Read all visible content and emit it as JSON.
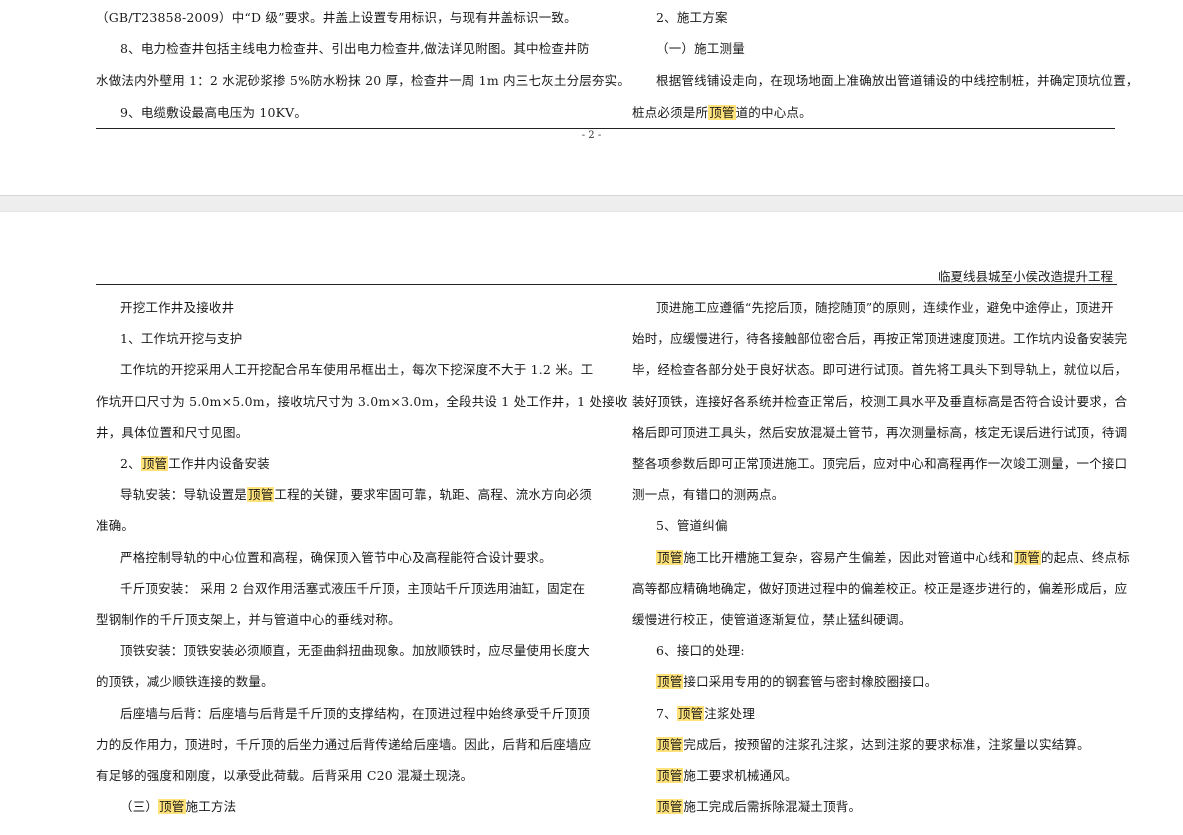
{
  "top_page": {
    "left": [
      "（GB/T23858-2009）中“D 级”要求。井盖上设置专用标识，与现有井盖标识一致。",
      "8、电力检查井包括主线电力检查井、引出电力检查井,做法详见附图。其中检查井防",
      "水做法内外壁用 1：2 水泥砂浆掺 5%防水粉抹 20 厚，检查井一周 1m 内三七灰土分层夯实。",
      "9、电缆敷设最高电压为 10KV。"
    ],
    "right": [
      "2、施工方案",
      "（一）施工测量",
      "根据管线铺设走向，在现场地面上准确放出管道铺设的中线控制桩，并确定顶坑位置，",
      {
        "pre": "桩点必须是所",
        "hl": "顶管",
        "post": "道的中心点。"
      }
    ],
    "page_number": "- 2 -"
  },
  "bottom_page": {
    "header": "临夏线县城至小侯改造提升工程",
    "left": [
      {
        "text": "开挖工作井及接收井",
        "indent": true
      },
      {
        "text": "1、工作坑开挖与支护",
        "indent": true
      },
      {
        "text": "工作坑的开挖采用人工开挖配合吊车使用吊框出土，每次下挖深度不大于 1.2 米。工",
        "indent": true
      },
      {
        "text": "作坑开口尺寸为 5.0m×5.0m，接收坑尺寸为 3.0m×3.0m，全段共设 1 处工作井，1 处接收",
        "indent": false
      },
      {
        "text": "井，具体位置和尺寸见图。",
        "indent": false
      },
      {
        "pre": "2、",
        "hl": "顶管",
        "post": "工作井内设备安装",
        "indent": true
      },
      {
        "pre": "导轨安装：导轨设置是",
        "hl": "顶管",
        "post": "工程的关键，要求牢固可靠，轨距、高程、流水方向必须",
        "indent": true
      },
      {
        "text": "准确。",
        "indent": false
      },
      {
        "text": "严格控制导轨的中心位置和高程，确保顶入管节中心及高程能符合设计要求。",
        "indent": true
      },
      {
        "text": "千斤顶安装： 采用 2 台双作用活塞式液压千斤顶，主顶站千斤顶选用油缸，固定在",
        "indent": true
      },
      {
        "text": "型钢制作的千斤顶支架上，并与管道中心的垂线对称。",
        "indent": false
      },
      {
        "text": "顶铁安装：顶铁安装必须顺直，无歪曲斜扭曲现象。加放顺铁时，应尽量使用长度大",
        "indent": true
      },
      {
        "text": "的顶铁，减少顺铁连接的数量。",
        "indent": false
      },
      {
        "text": "后座墙与后背：后座墙与后背是千斤顶的支撑结构，在顶进过程中始终承受千斤顶顶",
        "indent": true
      },
      {
        "text": "力的反作用力，顶进时，千斤顶的后坐力通过后背传递给后座墙。因此，后背和后座墙应",
        "indent": false
      },
      {
        "text": "有足够的强度和刚度，以承受此荷载。后背采用 C20 混凝土现浇。",
        "indent": false
      },
      {
        "pre": "（三）",
        "hl": "顶管",
        "post": "施工方法",
        "indent": true
      }
    ],
    "right": [
      {
        "text": "顶进施工应遵循“先挖后顶，随挖随顶”的原则，连续作业，避免中途停止，顶进开",
        "indent": true
      },
      {
        "text": "始时，应缓慢进行，待各接触部位密合后，再按正常顶进速度顶进。工作坑内设备安装完",
        "indent": false
      },
      {
        "text": "毕，经检查各部分处于良好状态。即可进行试顶。首先将工具头下到导轨上，就位以后，",
        "indent": false
      },
      {
        "text": "装好顶铁，连接好各系统并检查正常后，校测工具水平及垂直标高是否符合设计要求，合",
        "indent": false
      },
      {
        "text": "格后即可顶进工具头，然后安放混凝土管节，再次测量标高，核定无误后进行试顶，待调",
        "indent": false
      },
      {
        "text": "整各项参数后即可正常顶进施工。顶完后，应对中心和高程再作一次竣工测量，一个接口",
        "indent": false
      },
      {
        "text": "测一点，有错口的测两点。",
        "indent": false
      },
      {
        "text": "5、管道纠偏",
        "indent": true
      },
      {
        "hl": "顶管",
        "mid": "施工比开槽施工复杂，容易产生偏差，因此对管道中心线和",
        "hl2": "顶管",
        "post": "的起点、终点标",
        "indent": true
      },
      {
        "text": "高等都应精确地确定，做好顶进过程中的偏差校正。校正是逐步进行的，偏差形成后，应",
        "indent": false
      },
      {
        "text": "缓慢进行校正，使管道逐渐复位，禁止猛纠硬调。",
        "indent": false
      },
      {
        "text": "6、接口的处理:",
        "indent": true
      },
      {
        "hl": "顶管",
        "post": "接口采用专用的的钢套管与密封橡胶圈接口。",
        "indent": true
      },
      {
        "pre": "7、",
        "hl": "顶管",
        "post": "注浆处理",
        "indent": true
      },
      {
        "hl": "顶管",
        "post": "完成后，按预留的注浆孔注浆，达到注浆的要求标准，注浆量以实结算。",
        "indent": true
      },
      {
        "hl": "顶管",
        "post": "施工要求机械通风。",
        "indent": true
      },
      {
        "hl": "顶管",
        "post": "施工完成后需拆除混凝土顶背。",
        "indent": true
      }
    ]
  },
  "colors": {
    "highlight": "#ffe27a",
    "page_gap": "#eeeeee",
    "text": "#1a1a1a"
  }
}
